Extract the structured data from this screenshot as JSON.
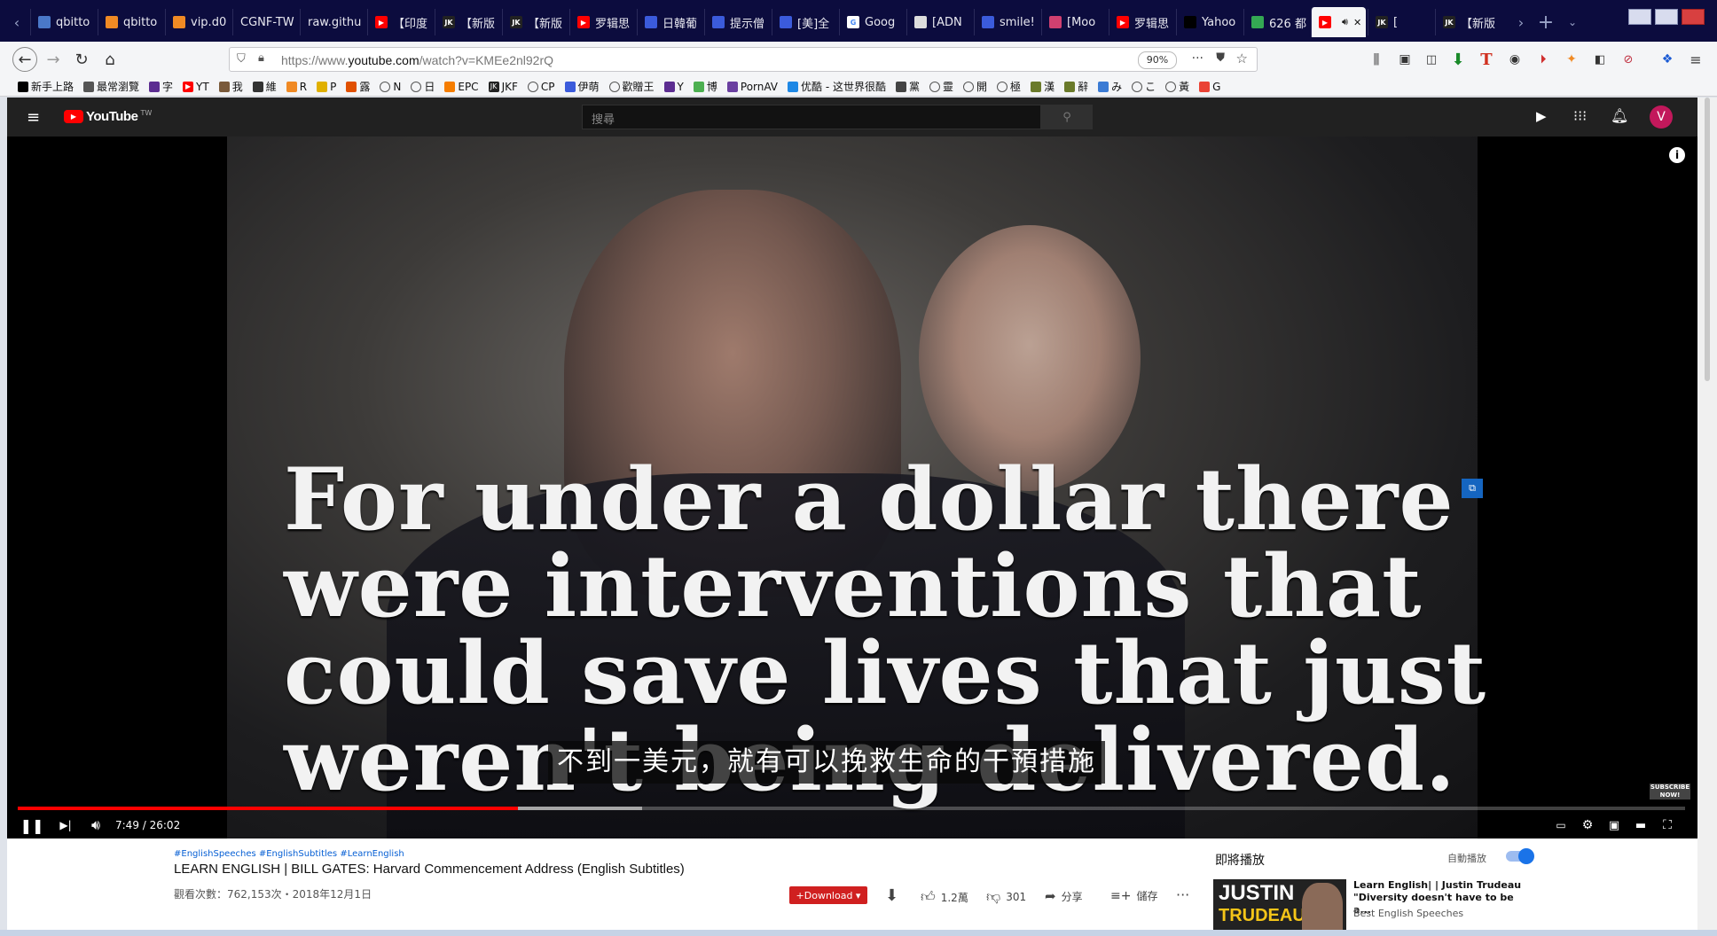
{
  "browser": {
    "tabs": [
      {
        "label": "qbitto",
        "icon": "qbittorrent-icon",
        "color": "#4a78c8"
      },
      {
        "label": "qbitto",
        "icon": "chart-icon",
        "color": "#f08a24"
      },
      {
        "label": "vip.d0",
        "icon": "chart-icon",
        "color": "#f08a24"
      },
      {
        "label": "CGNF-TW",
        "icon": "none",
        "color": "#000000"
      },
      {
        "label": "raw.githu",
        "icon": "none",
        "color": "#000000"
      },
      {
        "label": "【印度",
        "icon": "youtube-icon",
        "color": "#ff0000"
      },
      {
        "label": "【新版",
        "icon": "jk-icon",
        "color": "#222222"
      },
      {
        "label": "【新版",
        "icon": "jk-icon",
        "color": "#222222"
      },
      {
        "label": "罗辑思",
        "icon": "youtube-icon",
        "color": "#ff0000"
      },
      {
        "label": "日韓葡",
        "icon": "document-icon",
        "color": "#3b5bdb"
      },
      {
        "label": "提示僧",
        "icon": "document-icon",
        "color": "#3b5bdb"
      },
      {
        "label": "[美]全",
        "icon": "document-icon",
        "color": "#3b5bdb"
      },
      {
        "label": "Goog",
        "icon": "google-icon",
        "color": "#ffffff"
      },
      {
        "label": "[ADN",
        "icon": "clapper-icon",
        "color": "#dddddd"
      },
      {
        "label": "smile!",
        "icon": "document-icon",
        "color": "#3b5bdb"
      },
      {
        "label": "[Moo",
        "icon": "moon-icon",
        "color": "#d04070"
      },
      {
        "label": "罗辑思",
        "icon": "youtube-icon",
        "color": "#ff0000"
      },
      {
        "label": "Yahoo",
        "icon": "yahoo-icon",
        "color": "#000000"
      },
      {
        "label": "626 都",
        "icon": "maps-icon",
        "color": "#34a853"
      },
      {
        "label": "",
        "icon": "youtube-icon",
        "color": "#ff0000",
        "active": true
      },
      {
        "label": "[",
        "icon": "jk-icon",
        "color": "#222222"
      },
      {
        "label": "【新版",
        "icon": "jk-icon",
        "color": "#222222"
      }
    ],
    "url_prefix": "https://www.",
    "url_host": "youtube.com",
    "url_path": "/watch?v=KMEe2nl92rQ",
    "zoom": "90%",
    "bookmarks": [
      {
        "label": "新手上路",
        "icon": "mozilla-icon",
        "color": "#000000"
      },
      {
        "label": "最常瀏覽",
        "icon": "gear-icon",
        "color": "#555555"
      },
      {
        "label": "字",
        "icon": "yahoo-icon",
        "color": "#5c2d91"
      },
      {
        "label": "YT",
        "icon": "youtube-icon",
        "color": "#ff0000"
      },
      {
        "label": "我",
        "icon": "avatar-icon",
        "color": "#7a5a3a"
      },
      {
        "label": "維",
        "icon": "wikipedia-icon",
        "color": "#333333"
      },
      {
        "label": "R",
        "icon": "rss-icon",
        "color": "#f08a24"
      },
      {
        "label": "P",
        "icon": "plane-icon",
        "color": "#e0b000"
      },
      {
        "label": "露",
        "icon": "fire-icon",
        "color": "#e05000"
      },
      {
        "label": "N",
        "icon": "globe-icon",
        "color": "#444444"
      },
      {
        "label": "日",
        "icon": "globe-icon",
        "color": "#444444"
      },
      {
        "label": "EPC",
        "icon": "blogger-icon",
        "color": "#f57d00"
      },
      {
        "label": "JKF",
        "icon": "jk-icon",
        "color": "#222222"
      },
      {
        "label": "CP",
        "icon": "globe-icon",
        "color": "#444444"
      },
      {
        "label": "伊萌",
        "icon": "document-icon",
        "color": "#3b5bdb"
      },
      {
        "label": "歡贈王",
        "icon": "globe-icon",
        "color": "#444444"
      },
      {
        "label": "Y",
        "icon": "yahoo-icon",
        "color": "#5c2d91"
      },
      {
        "label": "博",
        "icon": "mail-icon",
        "color": "#4caf50"
      },
      {
        "label": "PornAV",
        "icon": "p-icon",
        "color": "#6a3fa0"
      },
      {
        "label": "优酷 - 这世界很酷",
        "icon": "youku-icon",
        "color": "#1e88e5"
      },
      {
        "label": "黨",
        "icon": "eye-icon",
        "color": "#444444"
      },
      {
        "label": "靈",
        "icon": "globe-icon",
        "color": "#444444"
      },
      {
        "label": "開",
        "icon": "globe-icon",
        "color": "#444444"
      },
      {
        "label": "極",
        "icon": "globe-icon",
        "color": "#444444"
      },
      {
        "label": "漢",
        "icon": "grass-icon",
        "color": "#6a7a2a"
      },
      {
        "label": "辭",
        "icon": "plant-icon",
        "color": "#6a7a2a"
      },
      {
        "label": "み",
        "icon": "kana-icon",
        "color": "#3b7bd4"
      },
      {
        "label": "こ",
        "icon": "globe-icon",
        "color": "#444444"
      },
      {
        "label": "黃",
        "icon": "globe-icon",
        "color": "#444444"
      },
      {
        "label": "G",
        "icon": "google-icon",
        "color": "#ea4335"
      }
    ]
  },
  "youtube": {
    "logo_text": "YouTube",
    "region": "TW",
    "search_placeholder": "搜尋",
    "avatar_letter": "V",
    "caption_lines": [
      "For under a dollar there",
      "were interventions that",
      "could save lives that just",
      "weren't being delivered."
    ],
    "subtitle": "不到一美元，就有可以挽救生命的干預措施",
    "time": "7:49 / 26:02",
    "progress_played": 0.3,
    "progress_buffered": 0.3745,
    "subscribe_badge": "SUBSCRIBE NOW!",
    "hashtags": "#EnglishSpeeches #EnglishSubtitles #LearnEnglish",
    "title": "LEARN ENGLISH | BILL GATES: Harvard Commencement Address (English Subtitles)",
    "meta": "觀看次數：762,153次・2018年12月1日",
    "download_label": "+Download ▾",
    "likes": "1.2萬",
    "dislikes": "301",
    "share_label": "分享",
    "save_label": "儲存",
    "up_next_label": "即將播放",
    "autoplay_label": "自動播放",
    "next_video": {
      "title": "Learn English| | Justin Trudeau \"Diversity doesn't have to be a...",
      "channel": "Best English Speeches",
      "thumb_line1": "JUSTIN",
      "thumb_line2": "TRUDEAU"
    },
    "accent": "#ff0000",
    "toggle_color": "#1a73e8"
  }
}
